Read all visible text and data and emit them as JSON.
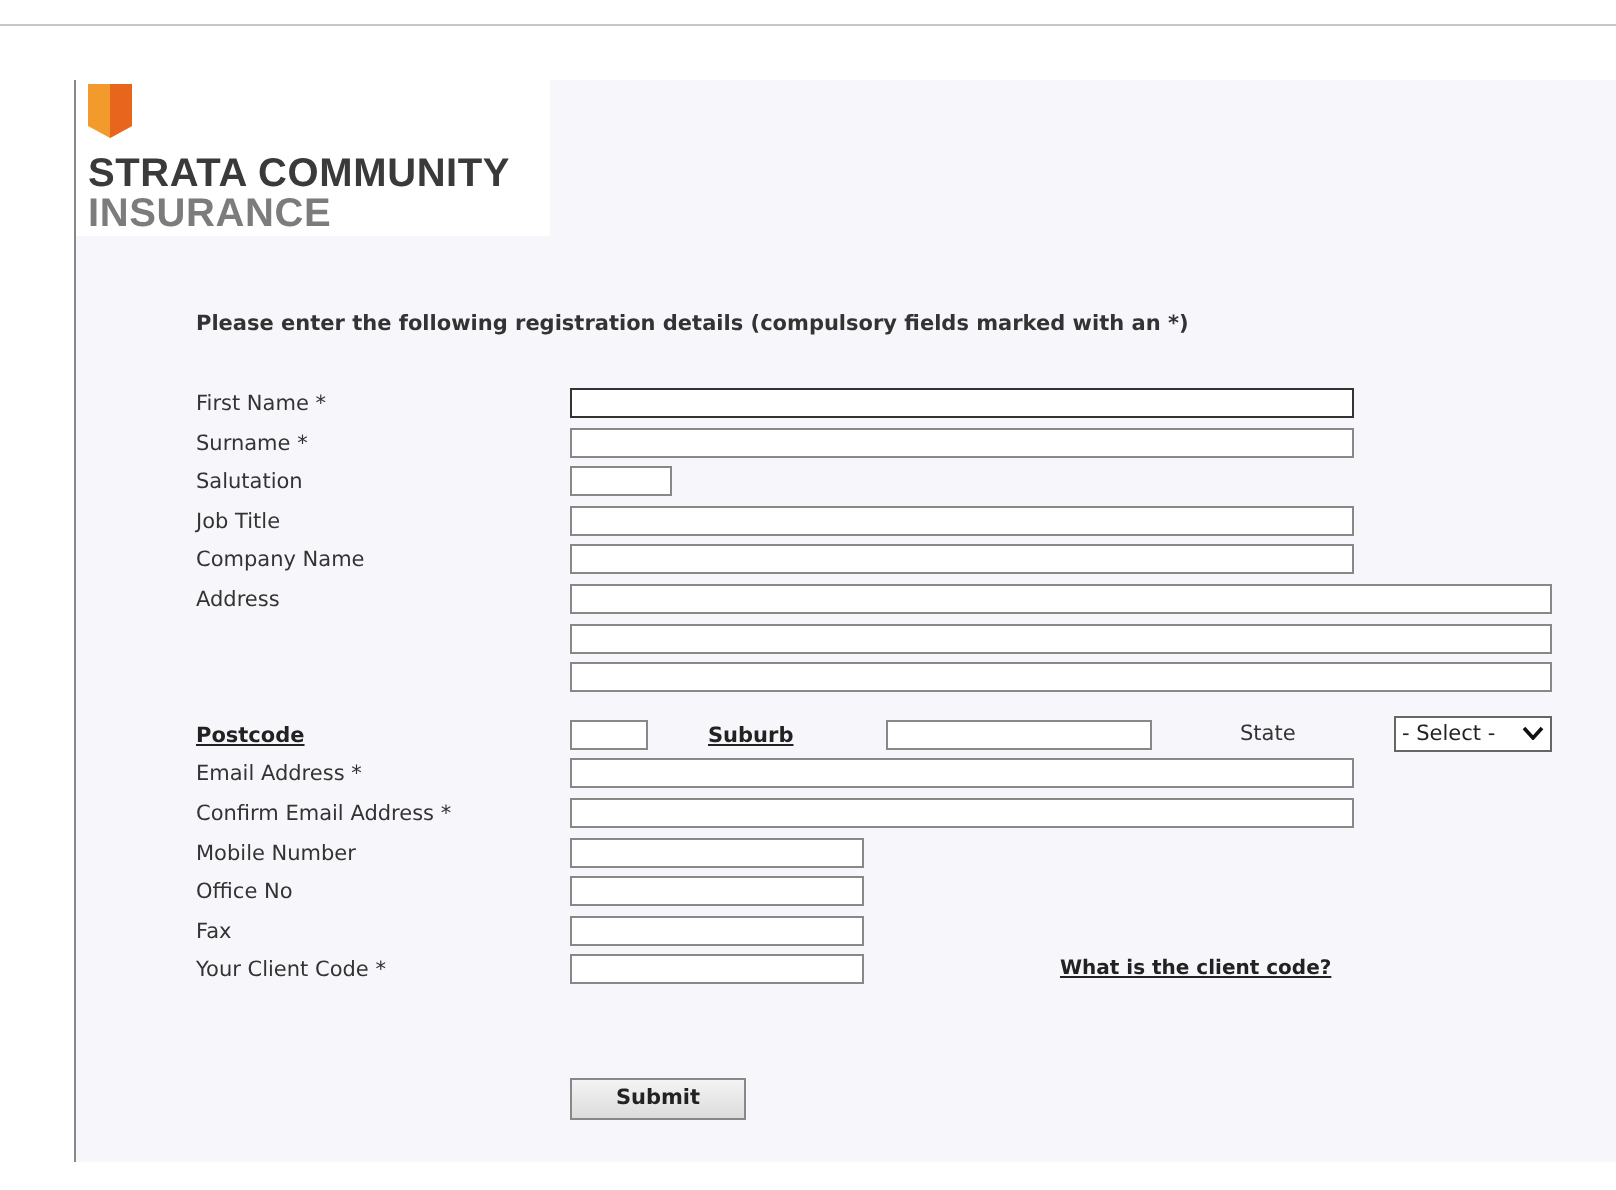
{
  "logo": {
    "line1": "STRATA COMMUNITY",
    "line2": "INSURANCE"
  },
  "heading": "Please enter the following registration details (compulsory fields marked with an *)",
  "fields": [
    {
      "kind": "wide",
      "label": "First Name *",
      "focused": true
    },
    {
      "kind": "wide",
      "label": "Surname *",
      "focused": false
    },
    {
      "kind": "tiny",
      "label": "Salutation",
      "focused": false
    },
    {
      "kind": "wide",
      "label": "Job Title",
      "focused": false
    },
    {
      "kind": "wide",
      "label": "Company Name",
      "focused": false
    },
    {
      "kind": "address",
      "label": "Address",
      "focused": false
    },
    {
      "kind": "location",
      "label": "Postcode",
      "suburb_label": "Suburb",
      "state_label": "State",
      "state_select": "- Select -",
      "focused": false
    },
    {
      "kind": "wide",
      "label": "Email Address *",
      "focused": false
    },
    {
      "kind": "wide",
      "label": "Confirm Email Address *",
      "focused": false
    },
    {
      "kind": "medium",
      "label": "Mobile Number",
      "focused": false
    },
    {
      "kind": "medium",
      "label": "Office No",
      "focused": false
    },
    {
      "kind": "medium",
      "label": "Fax",
      "focused": false
    },
    {
      "kind": "medium",
      "label": "Your Client Code *",
      "link": "What is the client code?",
      "focused": false
    }
  ],
  "submit": "Submit"
}
